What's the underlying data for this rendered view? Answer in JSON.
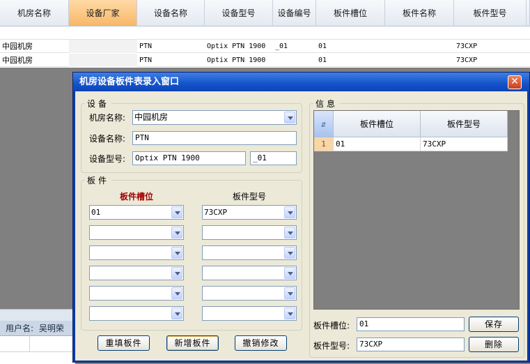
{
  "grid": {
    "columns": [
      "机房名称",
      "设备厂家",
      "设备名称",
      "设备型号",
      "设备编号",
      "板件槽位",
      "板件名称",
      "板件型号"
    ],
    "selected_column": "设备厂家",
    "rows": [
      [
        "中园机房",
        "",
        "PTN",
        "Optix PTN 1900",
        "_01",
        "01",
        "",
        "73CXP"
      ],
      [
        "中园机房",
        "",
        "PTN",
        "Optix PTN 1900",
        "",
        "01",
        "",
        "73CXP"
      ]
    ]
  },
  "status": {
    "user_label": "用户名:",
    "user_name": "吴明荣"
  },
  "dialog": {
    "title": "机房设备板件表录入窗口",
    "close_glyph": "✕",
    "device": {
      "legend": "设备",
      "room_label": "机房名称:",
      "room_value": "中园机房",
      "name_label": "设备名称:",
      "name_value": "PTN",
      "model_label": "设备型号:",
      "model_value": "Optix PTN 1900",
      "number_value": "_01"
    },
    "board": {
      "legend": "板件",
      "slot_header": "板件槽位",
      "model_header": "板件型号",
      "slots": [
        "01",
        "",
        "",
        "",
        "",
        ""
      ],
      "models": [
        "73CXP",
        "",
        "",
        "",
        "",
        ""
      ]
    },
    "buttons": {
      "refill": "重填板件",
      "add": "新增板件",
      "undo": "撤销修改"
    },
    "info": {
      "legend": "信息",
      "corner_icon": "sort-icon",
      "headers": [
        "板件槽位",
        "板件型号"
      ],
      "rows": [
        {
          "index": "1",
          "slot": "01",
          "model": "73CXP"
        }
      ],
      "slot_label": "板件槽位:",
      "slot_value": "01",
      "model_label": "板件型号:",
      "model_value": "73CXP",
      "save": "保存",
      "delete": "删除"
    }
  }
}
